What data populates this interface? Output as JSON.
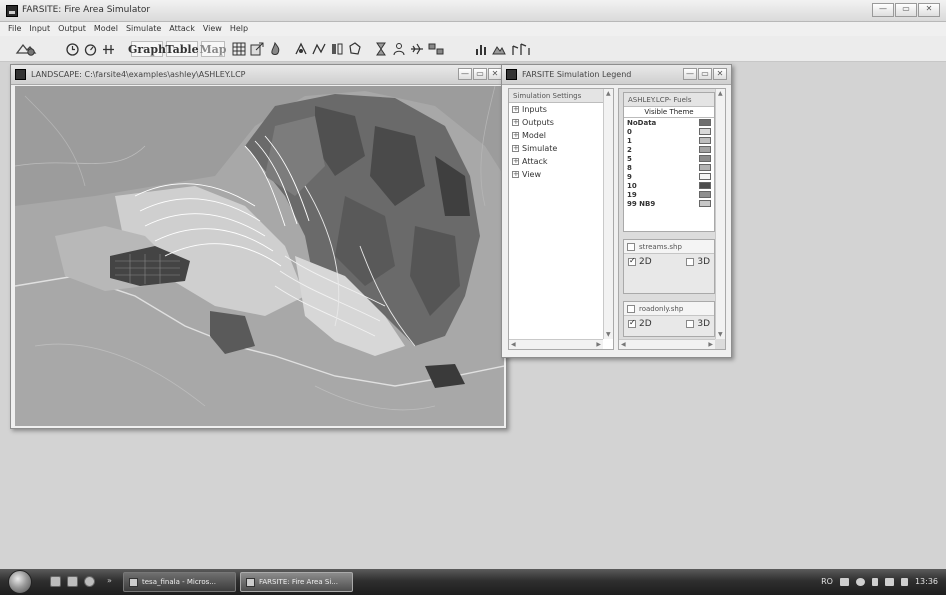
{
  "app": {
    "title": "FARSITE: Fire Area Simulator",
    "controls": [
      "—",
      "▭",
      "✕"
    ]
  },
  "menu": [
    "File",
    "Input",
    "Output",
    "Model",
    "Simulate",
    "Attack",
    "View",
    "Help"
  ],
  "toolbar": {
    "graph_label": "Graph",
    "table_label": "Table",
    "map_label": "Map"
  },
  "landscape_window": {
    "title": "LANDSCAPE: C:\\farsite4\\examples\\ashley\\ASHLEY.LCP"
  },
  "legend_window": {
    "title": "FARSITE Simulation Legend",
    "settings": {
      "header": "Simulation Settings",
      "items": [
        "Inputs",
        "Outputs",
        "Model",
        "Simulate",
        "Attack",
        "View"
      ]
    },
    "fuels": {
      "header": "ASHLEY.LCP- Fuels",
      "column_title": "Visible Theme",
      "rows": [
        {
          "label": "NoData",
          "color": "#6f6f6f"
        },
        {
          "label": "0",
          "color": "#d9d9d9"
        },
        {
          "label": "1",
          "color": "#bdbdbd"
        },
        {
          "label": "2",
          "color": "#a3a3a3"
        },
        {
          "label": "5",
          "color": "#8c8c8c"
        },
        {
          "label": "8",
          "color": "#b3b3b3"
        },
        {
          "label": "9",
          "color": "#f4f4f4"
        },
        {
          "label": "10",
          "color": "#4d4d4d"
        },
        {
          "label": "19",
          "color": "#8f8f8f"
        },
        {
          "label": "99 NB9",
          "color": "#c7c7c7"
        }
      ]
    },
    "layers": [
      {
        "name": "streams.shp",
        "opt_2d": "2D",
        "opt_3d": "3D",
        "checked_2d": true
      },
      {
        "name": "roadonly.shp",
        "opt_2d": "2D",
        "opt_3d": "3D",
        "checked_2d": true
      }
    ]
  },
  "taskbar": {
    "tasks": [
      "tesa_finala - Micros...",
      "FARSITE: Fire Area Si..."
    ],
    "tray": {
      "lang": "RO",
      "time": "13:36"
    }
  }
}
